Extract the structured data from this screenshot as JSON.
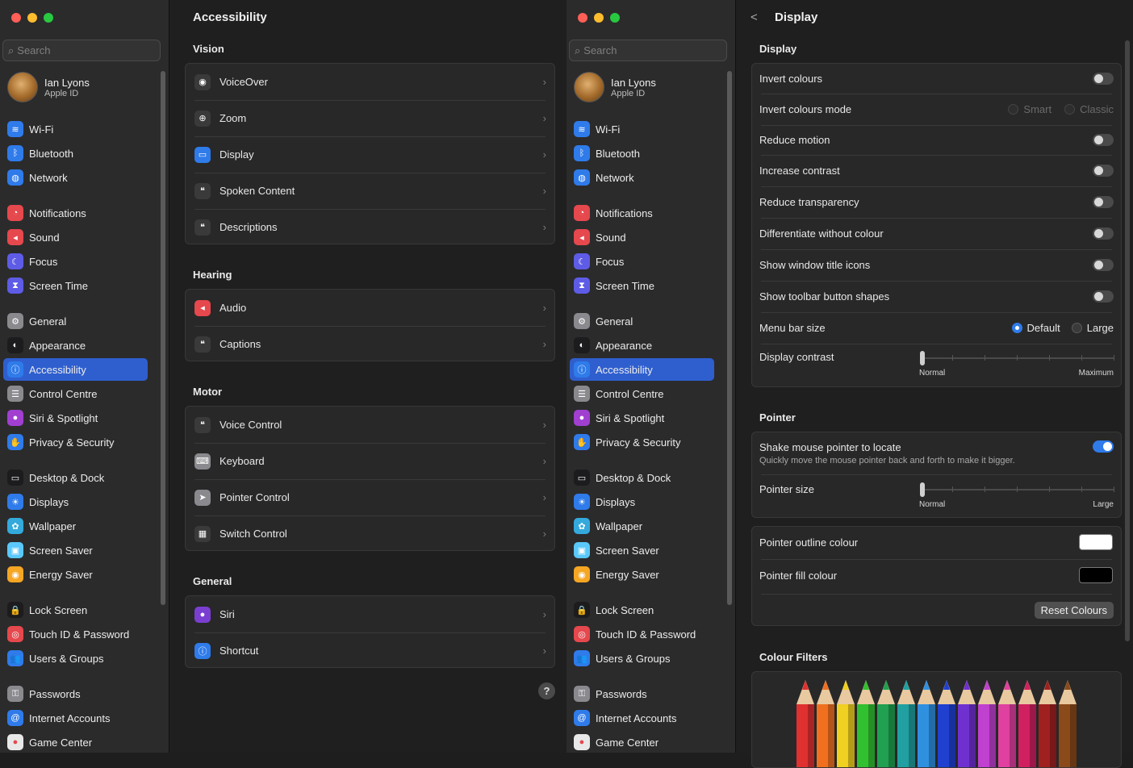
{
  "sidebar": {
    "search_placeholder": "Search",
    "account": {
      "name": "Ian Lyons",
      "sub": "Apple ID"
    },
    "items": [
      {
        "label": "Wi-Fi",
        "icon": "wifi-icon",
        "color": "#2f7bea",
        "glyph": "≋"
      },
      {
        "label": "Bluetooth",
        "icon": "bluetooth-icon",
        "color": "#2f7bea",
        "glyph": "ᛒ"
      },
      {
        "label": "Network",
        "icon": "globe-icon",
        "color": "#2f7bea",
        "glyph": "◍"
      },
      {
        "label": "Notifications",
        "icon": "bell-icon",
        "color": "#e5484d",
        "glyph": "◔"
      },
      {
        "label": "Sound",
        "icon": "speaker-icon",
        "color": "#e5484d",
        "glyph": "◂"
      },
      {
        "label": "Focus",
        "icon": "moon-icon",
        "color": "#5e5ce6",
        "glyph": "☾"
      },
      {
        "label": "Screen Time",
        "icon": "hourglass-icon",
        "color": "#5e5ce6",
        "glyph": "⧗"
      },
      {
        "label": "General",
        "icon": "gear-icon",
        "color": "#8a8a8e",
        "glyph": "⚙"
      },
      {
        "label": "Appearance",
        "icon": "appearance-icon",
        "color": "#1c1c1e",
        "glyph": "◐"
      },
      {
        "label": "Accessibility",
        "icon": "accessibility-icon",
        "color": "#2f7bea",
        "glyph": "ⓘ"
      },
      {
        "label": "Control Centre",
        "icon": "control-centre-icon",
        "color": "#8a8a8e",
        "glyph": "☰"
      },
      {
        "label": "Siri & Spotlight",
        "icon": "siri-icon",
        "color": "#a03fd0",
        "glyph": "●"
      },
      {
        "label": "Privacy & Security",
        "icon": "hand-icon",
        "color": "#2f7bea",
        "glyph": "✋"
      },
      {
        "label": "Desktop & Dock",
        "icon": "dock-icon",
        "color": "#1c1c1e",
        "glyph": "▭"
      },
      {
        "label": "Displays",
        "icon": "sun-icon",
        "color": "#2f7bea",
        "glyph": "☀"
      },
      {
        "label": "Wallpaper",
        "icon": "flower-icon",
        "color": "#34aadc",
        "glyph": "✿"
      },
      {
        "label": "Screen Saver",
        "icon": "screensaver-icon",
        "color": "#5ac8fa",
        "glyph": "▣"
      },
      {
        "label": "Energy Saver",
        "icon": "lightbulb-icon",
        "color": "#f5a623",
        "glyph": "◉"
      },
      {
        "label": "Lock Screen",
        "icon": "lock-icon",
        "color": "#1c1c1e",
        "glyph": "🔒"
      },
      {
        "label": "Touch ID & Password",
        "icon": "fingerprint-icon",
        "color": "#e5484d",
        "glyph": "◎"
      },
      {
        "label": "Users & Groups",
        "icon": "users-icon",
        "color": "#2f7bea",
        "glyph": "👥"
      },
      {
        "label": "Passwords",
        "icon": "key-icon",
        "color": "#8a8a8e",
        "glyph": "⚿"
      },
      {
        "label": "Internet Accounts",
        "icon": "at-icon",
        "color": "#2f7bea",
        "glyph": "@"
      },
      {
        "label": "Game Center",
        "icon": "gamecenter-icon",
        "color": "#e8e8e8",
        "glyph": "●"
      }
    ],
    "active": "Accessibility"
  },
  "accessibility": {
    "title": "Accessibility",
    "sections": [
      {
        "heading": "Vision",
        "rows": [
          {
            "label": "VoiceOver",
            "icon": "voiceover-icon",
            "glyph": "◉"
          },
          {
            "label": "Zoom",
            "icon": "zoom-icon",
            "glyph": "⊕"
          },
          {
            "label": "Display",
            "icon": "display-icon",
            "glyph": "▭"
          },
          {
            "label": "Spoken Content",
            "icon": "speech-bubble-icon",
            "glyph": "❝"
          },
          {
            "label": "Descriptions",
            "icon": "descriptions-icon",
            "glyph": "❝"
          }
        ]
      },
      {
        "heading": "Hearing",
        "rows": [
          {
            "label": "Audio",
            "icon": "audio-icon",
            "glyph": "◂"
          },
          {
            "label": "Captions",
            "icon": "captions-icon",
            "glyph": "❝"
          }
        ]
      },
      {
        "heading": "Motor",
        "rows": [
          {
            "label": "Voice Control",
            "icon": "voice-control-icon",
            "glyph": "❝"
          },
          {
            "label": "Keyboard",
            "icon": "keyboard-icon",
            "glyph": "⌨"
          },
          {
            "label": "Pointer Control",
            "icon": "pointer-icon",
            "glyph": "➤"
          },
          {
            "label": "Switch Control",
            "icon": "switch-control-icon",
            "glyph": "▦"
          }
        ]
      },
      {
        "heading": "General",
        "rows": [
          {
            "label": "Siri",
            "icon": "siri-icon",
            "glyph": "●"
          },
          {
            "label": "Shortcut",
            "icon": "shortcut-icon",
            "glyph": "ⓘ"
          }
        ]
      }
    ],
    "help": "?"
  },
  "display": {
    "back": "<",
    "title": "Display",
    "display_heading": "Display",
    "rows": {
      "invert_colours": "Invert colours",
      "invert_mode": "Invert colours mode",
      "invert_mode_opts": [
        "Smart",
        "Classic"
      ],
      "reduce_motion": "Reduce motion",
      "increase_contrast": "Increase contrast",
      "reduce_transparency": "Reduce transparency",
      "differentiate": "Differentiate without colour",
      "window_title_icons": "Show window title icons",
      "toolbar_shapes": "Show toolbar button shapes",
      "menu_bar_size": "Menu bar size",
      "menu_bar_opts": [
        "Default",
        "Large"
      ],
      "display_contrast": "Display contrast",
      "contrast_min": "Normal",
      "contrast_max": "Maximum"
    },
    "display_contrast_level": 0,
    "pointer_heading": "Pointer",
    "pointer": {
      "shake": "Shake mouse pointer to locate",
      "shake_desc": "Quickly move the mouse pointer back and forth to make it bigger.",
      "size": "Pointer size",
      "size_min": "Normal",
      "size_max": "Large",
      "outline": "Pointer outline colour",
      "fill": "Pointer fill colour",
      "reset": "Reset Colours"
    },
    "pointer_size_level": 0,
    "pointer_outline_color": "#ffffff",
    "pointer_fill_color": "#000000",
    "filters_heading": "Colour Filters",
    "pencil_colors": [
      "#e03030",
      "#f07020",
      "#f0d020",
      "#30c030",
      "#20a050",
      "#20a0a0",
      "#3090e0",
      "#2040d0",
      "#7030d0",
      "#c040d0",
      "#e040a0",
      "#d02060",
      "#a02020",
      "#8a4a1a"
    ]
  }
}
